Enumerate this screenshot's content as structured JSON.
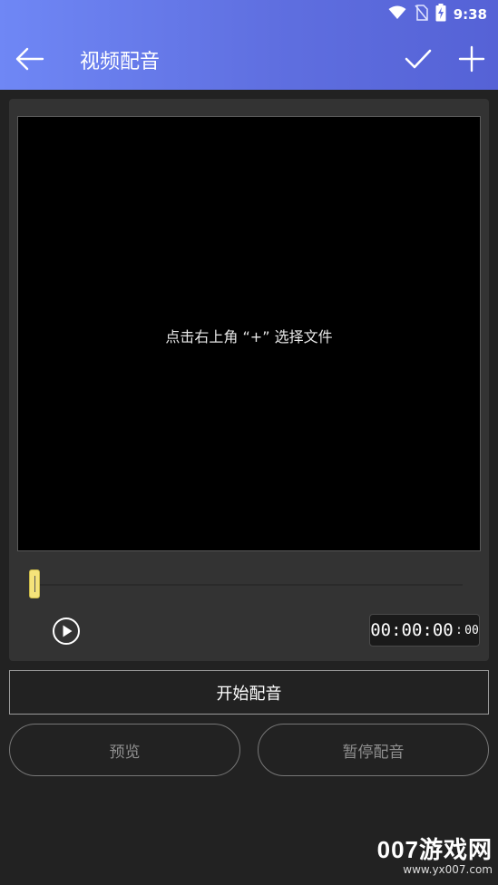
{
  "status_bar": {
    "time": "9:38",
    "icons": [
      "wifi-icon",
      "no-sim-icon",
      "battery-charging-icon"
    ]
  },
  "toolbar": {
    "title": "视频配音",
    "back_icon": "arrow-left-icon",
    "confirm_icon": "check-icon",
    "add_icon": "plus-icon"
  },
  "player": {
    "hint": "点击右上角 “+” 选择文件",
    "progress": 0,
    "time": {
      "main": "00:00:00",
      "separator": ":",
      "ms": "00"
    },
    "play_icon": "play-circle-icon"
  },
  "actions": {
    "start_label": "开始配音",
    "preview_label": "预览",
    "pause_label": "暂停配音"
  },
  "watermark": {
    "brand": "007游戏网",
    "url": "www.yx007.com"
  },
  "colors": {
    "appbar_start": "#6f87f5",
    "appbar_end": "#5562d6",
    "background": "#222222",
    "seek_handle": "#f5e37a"
  }
}
